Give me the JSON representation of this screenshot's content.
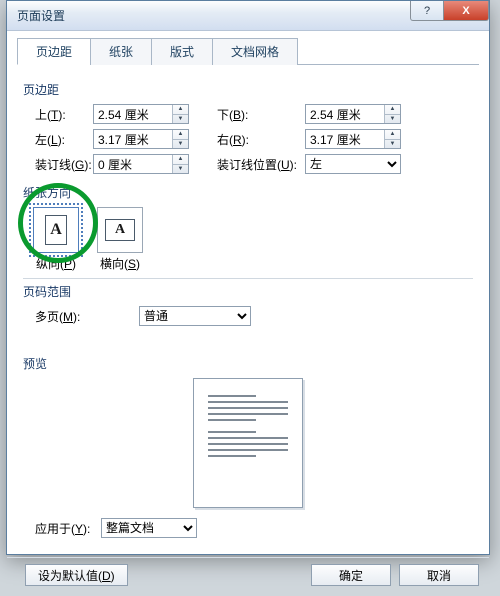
{
  "window": {
    "title": "页面设置",
    "help": "?",
    "close": "X"
  },
  "tabs": {
    "margins": "页边距",
    "paper": "纸张",
    "layout": "版式",
    "grid": "文档网格"
  },
  "margins": {
    "section_title": "页边距",
    "top_label": "上(T):",
    "top_value": "2.54 厘米",
    "bottom_label": "下(B):",
    "bottom_value": "2.54 厘米",
    "left_label": "左(L):",
    "left_value": "3.17 厘米",
    "right_label": "右(R):",
    "right_value": "3.17 厘米",
    "gutter_label": "装订线(G):",
    "gutter_value": "0 厘米",
    "gutter_pos_label": "装订线位置(U):",
    "gutter_pos_value": "左"
  },
  "orientation": {
    "section_title": "纸张方向",
    "portrait_label": "纵向(P)",
    "landscape_label": "横向(S)"
  },
  "pages": {
    "section_title": "页码范围",
    "multi_label": "多页(M):",
    "multi_value": "普通"
  },
  "preview": {
    "section_title": "预览"
  },
  "apply": {
    "label": "应用于(Y):",
    "value": "整篇文档"
  },
  "buttons": {
    "default": "设为默认值(D)",
    "ok": "确定",
    "cancel": "取消"
  }
}
